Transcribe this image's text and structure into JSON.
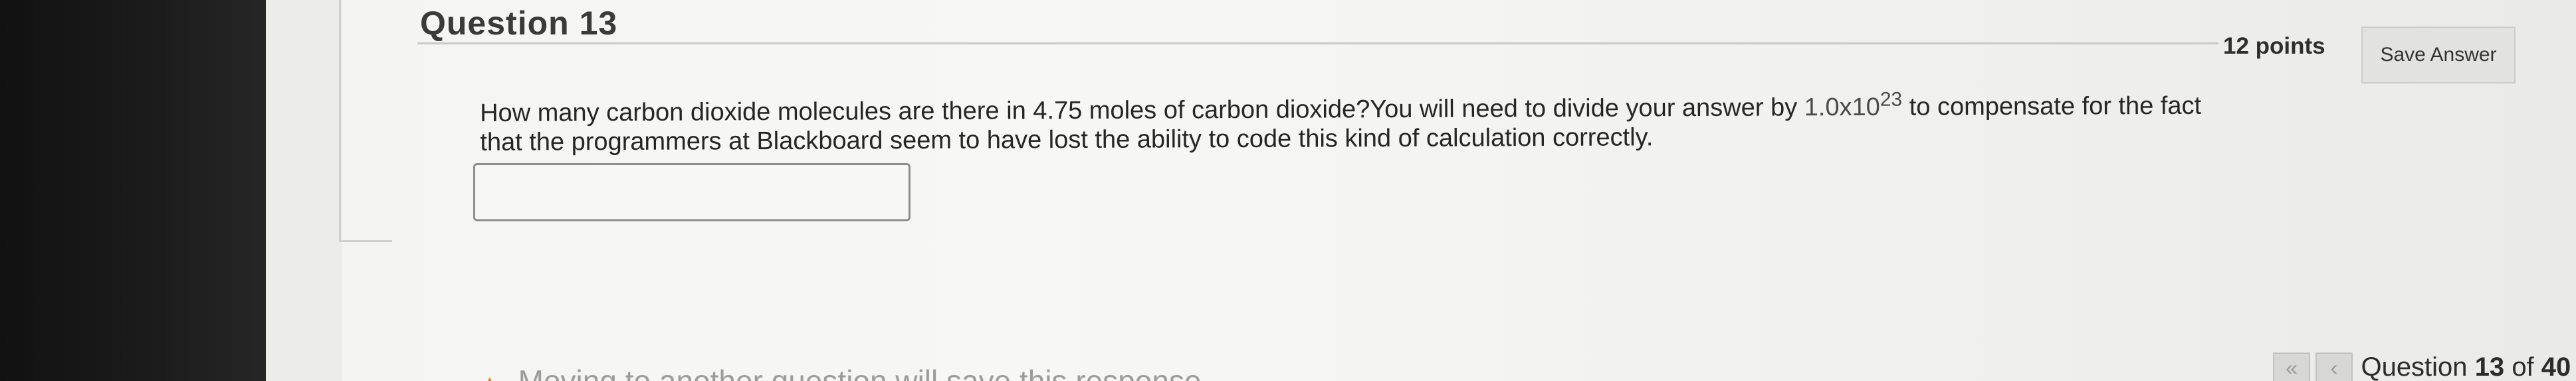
{
  "question": {
    "title": "Question 13",
    "points": "12 points",
    "save_label": "Save Answer",
    "text_line1": "How many carbon dioxide molecules are there in 4.75 moles of carbon dioxide?You will need to divide your answer by",
    "hint_base": "1.0x10",
    "hint_exponent": "23",
    "text_line1_end": "to compensate for the fact",
    "text_line2": "that the programmers at Blackboard seem to have lost the ability to code this kind of calculation correctly.",
    "answer_value": "",
    "answer_placeholder": ""
  },
  "footer": {
    "warning": "Moving to another question will save this response.",
    "warning_icon": "warning-triangle-icon",
    "nav_first": "«",
    "nav_prev": "‹",
    "nav_prefix": "Question",
    "nav_current": "13",
    "nav_of": "of",
    "nav_total": "40"
  }
}
